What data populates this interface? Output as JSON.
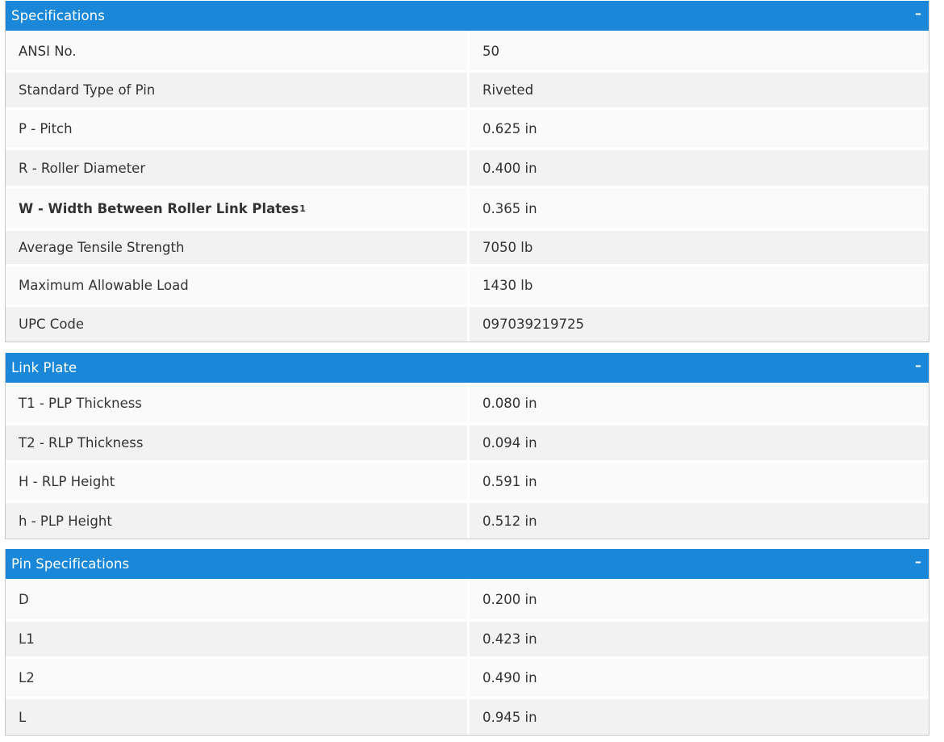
{
  "panels": [
    {
      "title": "Specifications",
      "collapse_symbol": "–",
      "rows": [
        {
          "label": "ANSI No.",
          "value": "50"
        },
        {
          "label": "Standard Type of Pin",
          "value": "Riveted"
        },
        {
          "label": "P - Pitch",
          "value": "0.625 in"
        },
        {
          "label": "R - Roller Diameter",
          "value": "0.400 in"
        },
        {
          "label": "W - Width Between Roller Link Plates",
          "footnote": "1",
          "value": "0.365 in"
        },
        {
          "label": "Average Tensile Strength",
          "value": "7050 lb"
        },
        {
          "label": "Maximum Allowable Load",
          "value": "1430 lb"
        },
        {
          "label": "UPC Code",
          "value": "097039219725"
        }
      ]
    },
    {
      "title": "Link Plate",
      "collapse_symbol": "–",
      "rows": [
        {
          "label": "T1 - PLP Thickness",
          "value": "0.080 in"
        },
        {
          "label": "T2 - RLP Thickness",
          "value": "0.094 in"
        },
        {
          "label": "H - RLP Height",
          "value": "0.591 in"
        },
        {
          "label": "h - PLP Height",
          "value": "0.512 in"
        }
      ]
    },
    {
      "title": "Pin Specifications",
      "collapse_symbol": "–",
      "rows": [
        {
          "label": "D",
          "value": "0.200 in"
        },
        {
          "label": "L1",
          "value": "0.423 in"
        },
        {
          "label": "L2",
          "value": "0.490 in"
        },
        {
          "label": "L",
          "value": "0.945 in"
        }
      ]
    }
  ],
  "colors": {
    "header_bg": "#1a87d8",
    "header_text": "#ffffff",
    "row_light": "#fafafa",
    "row_dark": "#f2f2f2",
    "text": "#333333"
  }
}
